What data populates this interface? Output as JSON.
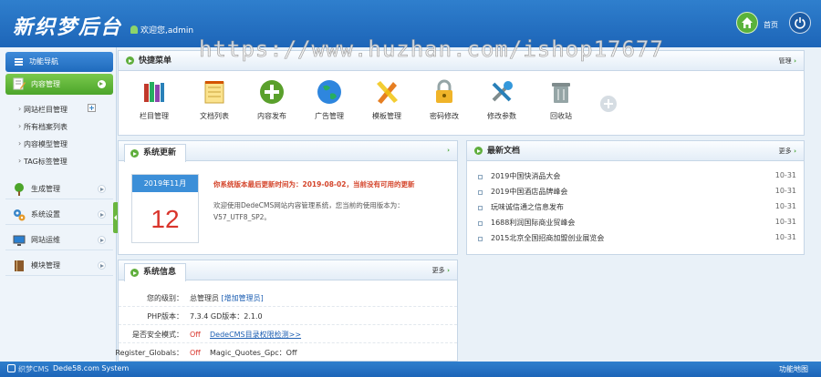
{
  "header": {
    "logo_text": "新织梦后台",
    "welcome": "欢迎您,admin",
    "home_label": "首页",
    "watermark": "https://www.huzhan.com/ishop17677"
  },
  "sidebar": {
    "nav_title": "功能导航",
    "active_menu": "内容管理",
    "sub_items": [
      "网站栏目管理",
      "所有档案列表",
      "内容模型管理",
      "TAG标签管理"
    ],
    "menus": [
      "生成管理",
      "系统设置",
      "网站运维",
      "模块管理"
    ]
  },
  "quick_menu": {
    "title": "快捷菜单",
    "manage": "管理",
    "items": [
      {
        "label": "栏目管理",
        "icon": "books-icon"
      },
      {
        "label": "文档列表",
        "icon": "notepad-icon"
      },
      {
        "label": "内容发布",
        "icon": "add-icon"
      },
      {
        "label": "广告管理",
        "icon": "globe-icon"
      },
      {
        "label": "模板管理",
        "icon": "pencil-ruler-icon"
      },
      {
        "label": "密码修改",
        "icon": "lock-icon"
      },
      {
        "label": "修改参数",
        "icon": "tools-icon"
      },
      {
        "label": "回收站",
        "icon": "trash-icon"
      }
    ]
  },
  "system_update": {
    "title": "系统更新",
    "calendar_month": "2019年11月",
    "calendar_day": "12",
    "notice": "你系统版本最后更新时间为：2019-08-02，当前没有可用的更新",
    "desc": "欢迎使用DedeCMS网站内容管理系统，您当前的使用版本为：V57_UTF8_SP2。"
  },
  "latest_docs": {
    "title": "最新文档",
    "more": "更多",
    "rows": [
      {
        "title": "2019中国快消品大会",
        "date": "10-31"
      },
      {
        "title": "2019中国酒店品牌峰会",
        "date": "10-31"
      },
      {
        "title": "玩味诚信通之信息发布",
        "date": "10-31"
      },
      {
        "title": "1688利润国际商业贸峰会",
        "date": "10-31"
      },
      {
        "title": "2015北京全国招商加盟创业展览会",
        "date": "10-31"
      }
    ]
  },
  "system_info": {
    "title": "系统信息",
    "more": "更多",
    "rows": [
      {
        "key": "您的级别：",
        "value": "总管理员",
        "link": "[增加管理员]"
      },
      {
        "key": "PHP版本：",
        "value": "7.3.4   GD版本：2.1.0"
      },
      {
        "key": "是否安全模式：",
        "value": "Off",
        "link": "DedeCMS目录权限检测>>"
      },
      {
        "key": "Register_Globals：",
        "value": "Off",
        "extra": "Magic_Quotes_Gpc：Off"
      }
    ]
  },
  "footer": {
    "left": "织梦CMS",
    "system": "Dede58.com System",
    "right": "功能地图"
  },
  "colors": {
    "header_blue": "#2f7fcd",
    "active_green": "#5fae3c",
    "calendar_blue": "#3c8fd8",
    "day_red": "#d9342b"
  }
}
